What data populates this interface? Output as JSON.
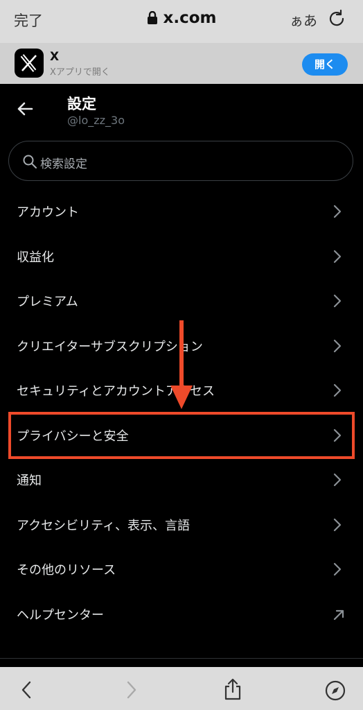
{
  "browser": {
    "done_label": "完了",
    "host": "x.com",
    "text_size_label": "ぁあ"
  },
  "app_banner": {
    "name": "X",
    "subtitle": "Xアプリで開く",
    "open_label": "開く"
  },
  "settings": {
    "title": "設定",
    "handle": "@lo_zz_3o",
    "search_placeholder": "検索設定",
    "items": [
      {
        "label": "アカウント",
        "icon": "chevron-right-icon"
      },
      {
        "label": "収益化",
        "icon": "chevron-right-icon"
      },
      {
        "label": "プレミアム",
        "icon": "chevron-right-icon"
      },
      {
        "label": "クリエイターサブスクリプション",
        "icon": "chevron-right-icon"
      },
      {
        "label": "セキュリティとアカウントアクセス",
        "icon": "chevron-right-icon"
      },
      {
        "label": "プライバシーと安全",
        "icon": "chevron-right-icon"
      },
      {
        "label": "通知",
        "icon": "chevron-right-icon"
      },
      {
        "label": "アクセシビリティ、表示、言語",
        "icon": "chevron-right-icon"
      },
      {
        "label": "その他のリソース",
        "icon": "chevron-right-icon"
      },
      {
        "label": "ヘルプセンター",
        "icon": "external-link-arrow-icon"
      }
    ]
  },
  "colors": {
    "accent_blue": "#1d8cf0",
    "highlight_red": "#ee4a2a",
    "background": "#000000"
  }
}
